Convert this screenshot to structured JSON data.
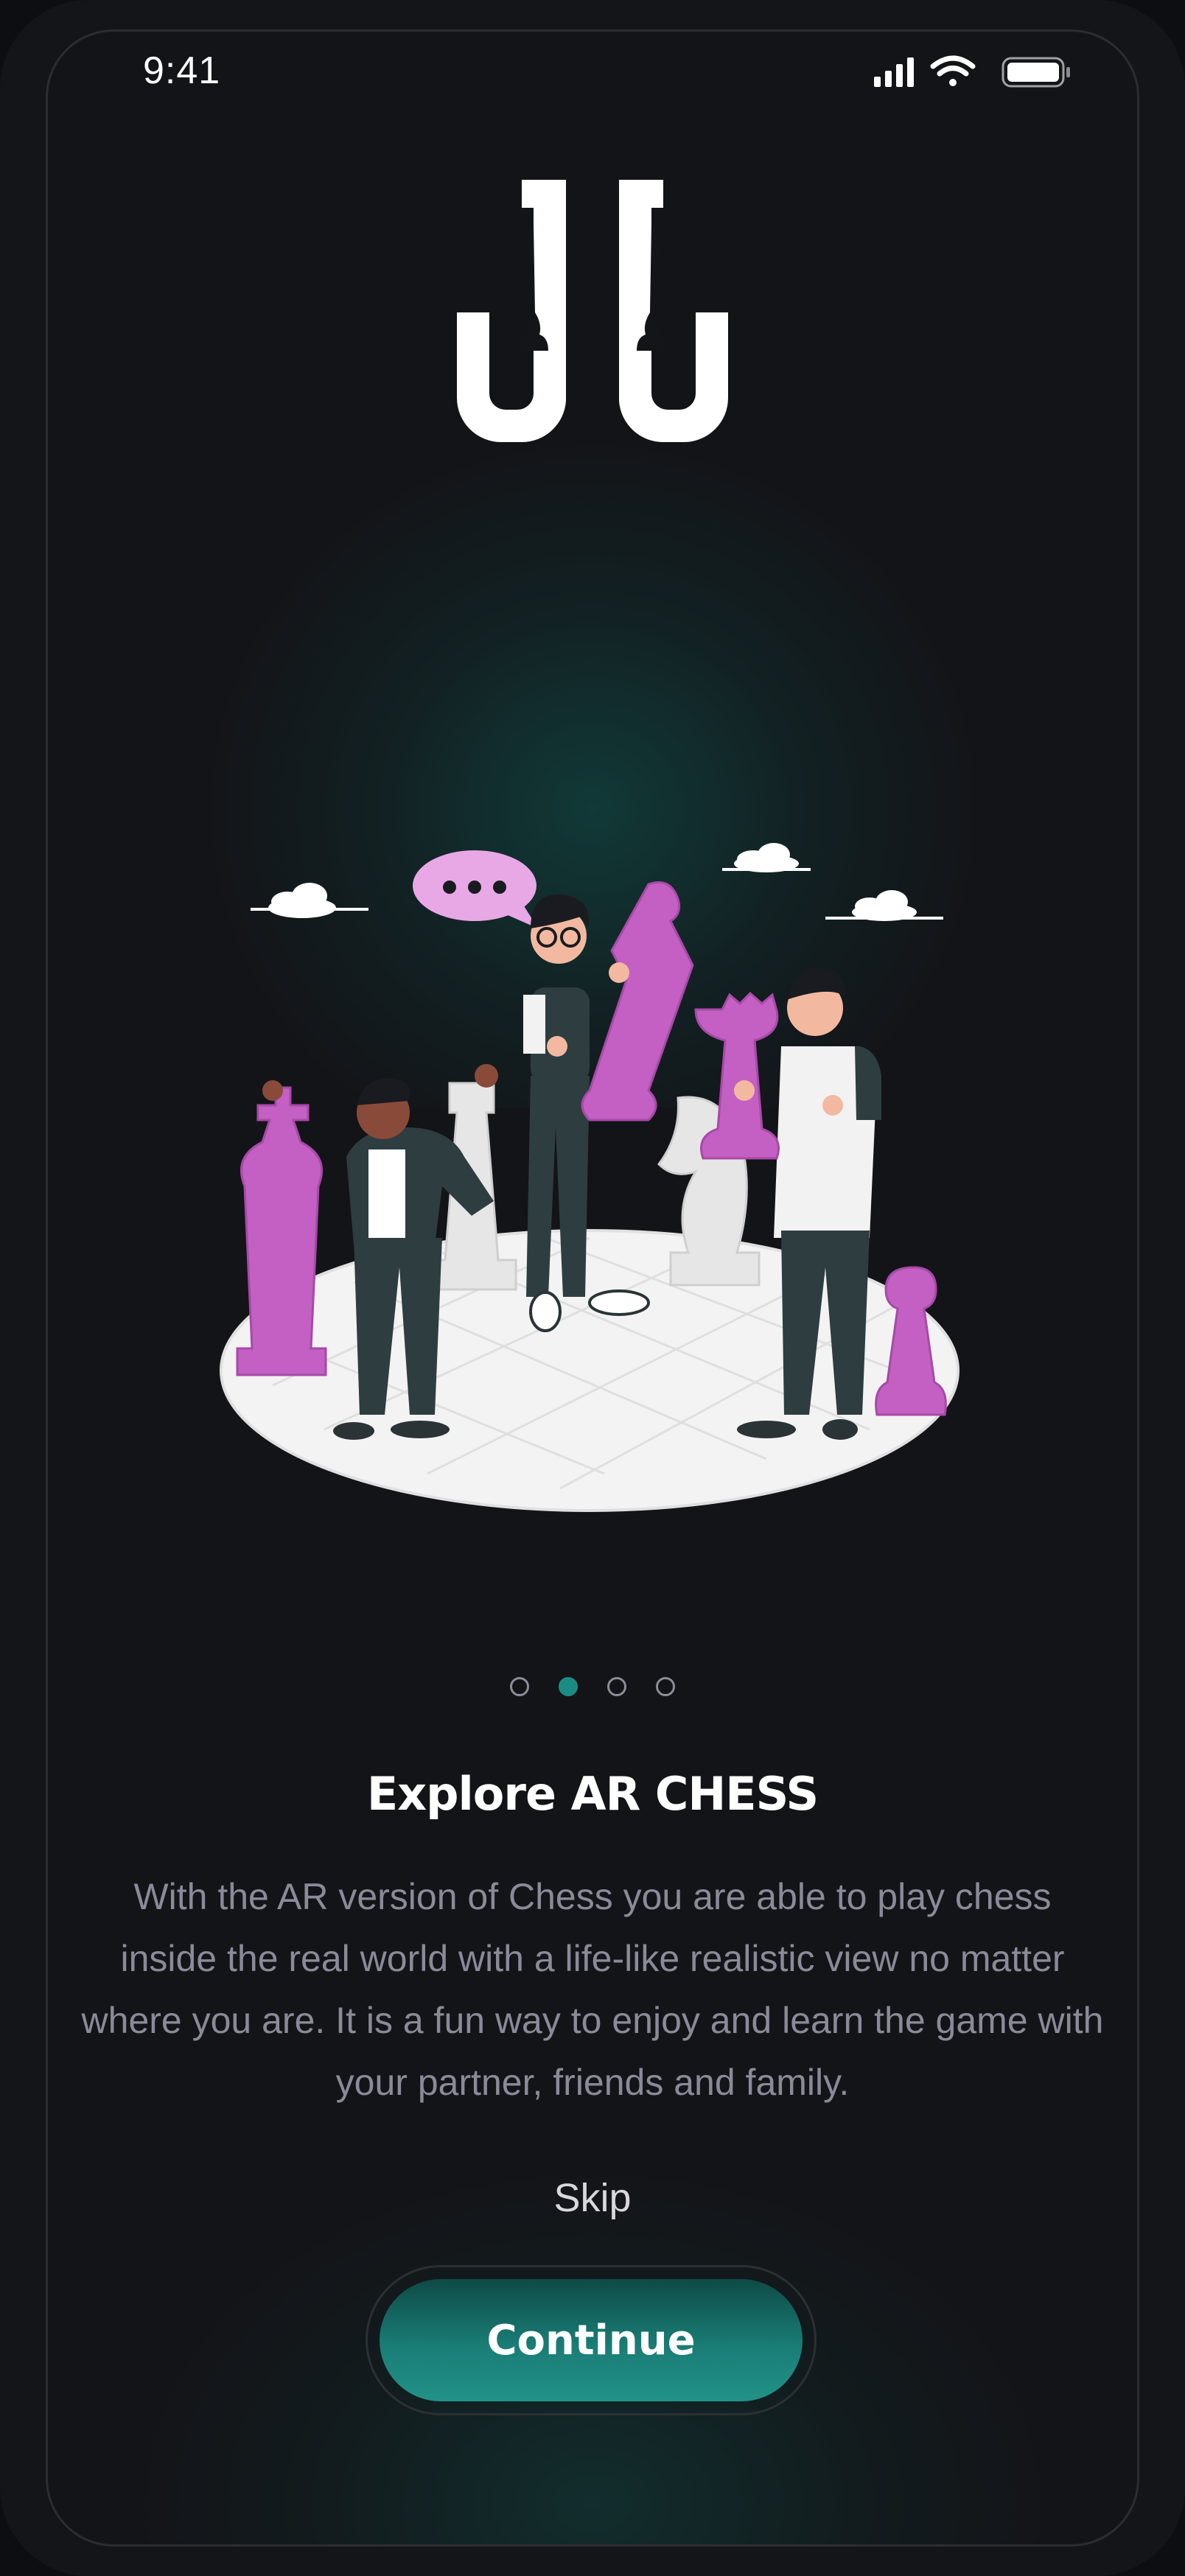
{
  "status_bar": {
    "time": "9:41"
  },
  "pagination": {
    "count": 4,
    "active_index": 1
  },
  "onboarding": {
    "title": "Explore AR CHESS",
    "description": "With the AR version of Chess you are able to play chess inside the real world with a life-like realistic view no matter where you are. It is a fun way to enjoy and learn the game with your partner, friends and family.",
    "skip_label": "Skip",
    "continue_label": "Continue"
  },
  "icons": [
    "signal-icon",
    "wifi-icon",
    "battery-icon",
    "app-logo",
    "chat-bubble-icon"
  ],
  "colors": {
    "accent": "#1b8c84",
    "background": "#131418",
    "piece": "#c45fc4"
  }
}
